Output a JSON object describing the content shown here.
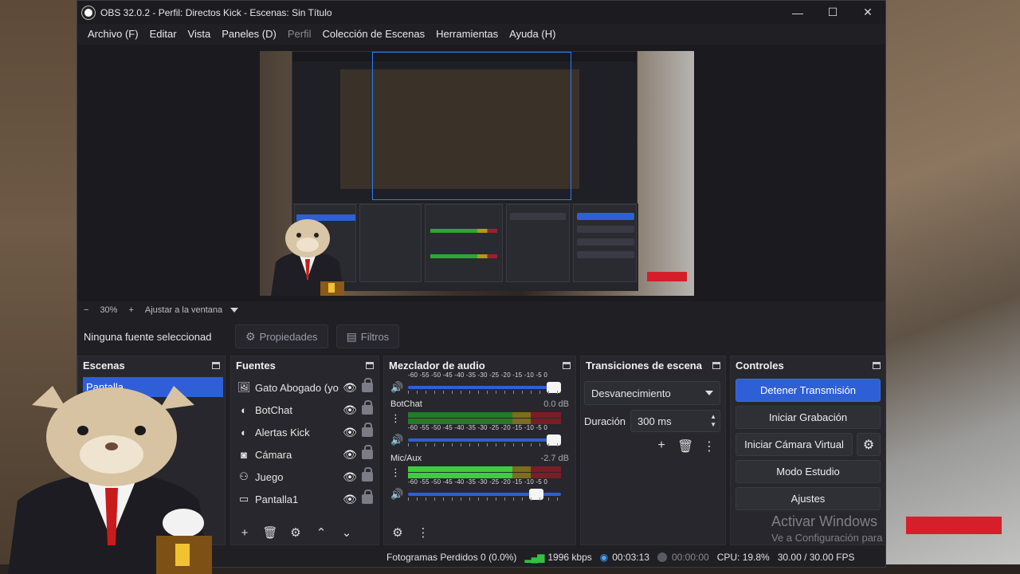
{
  "window": {
    "title": "OBS 32.0.2 - Perfil: Directos Kick - Escenas: Sin Título",
    "minimize": "—",
    "maximize": "☐",
    "close": "✕"
  },
  "menu": [
    "Archivo (F)",
    "Editar",
    "Vista",
    "Paneles (D)",
    "Perfil",
    "Colección de Escenas",
    "Herramientas",
    "Ayuda (H)"
  ],
  "zoom": {
    "minus": "−",
    "value": "30%",
    "plus": "+",
    "fit_label": "Ajustar a la ventana"
  },
  "source_toolbar": {
    "no_source": "Ninguna fuente seleccionad",
    "properties": "Propiedades",
    "filters": "Filtros"
  },
  "scenes": {
    "title": "Escenas",
    "items": [
      "Pantalla"
    ]
  },
  "sources": {
    "title": "Fuentes",
    "items": [
      {
        "name": "Gato Abogado (yo",
        "icon": "image-icon"
      },
      {
        "name": "BotChat",
        "icon": "browser-icon"
      },
      {
        "name": "Alertas Kick",
        "icon": "browser-icon"
      },
      {
        "name": "Cámara",
        "icon": "camera-icon"
      },
      {
        "name": "Juego",
        "icon": "gamepad-icon"
      },
      {
        "name": "Pantalla1",
        "icon": "monitor-icon"
      }
    ]
  },
  "mixer": {
    "title": "Mezclador de audio",
    "ticks": "-60 -55 -50 -45 -40 -35 -30 -25 -20 -15 -10 -5 0",
    "channels": [
      {
        "name": "",
        "db": "",
        "level": 0,
        "volume": 0.93
      },
      {
        "name": "BotChat",
        "db": "0.0 dB",
        "level": 0,
        "volume": 0.93
      },
      {
        "name": "Mic/Aux",
        "db": "-2.7 dB",
        "level": 0.78,
        "volume": 0.83
      }
    ]
  },
  "transitions": {
    "title": "Transiciones de escena",
    "selected": "Desvanecimiento",
    "duration_label": "Duración",
    "duration_value": "300 ms"
  },
  "controls": {
    "title": "Controles",
    "stop_stream": "Detener Transmisión",
    "start_recording": "Iniciar Grabación",
    "start_virtualcam": "Iniciar Cámara Virtual",
    "studio_mode": "Modo Estudio",
    "settings": "Ajustes"
  },
  "status": {
    "dropped": "Fotogramas Perdidos 0 (0.0%)",
    "bitrate": "1996 kbps",
    "stream_time": "00:03:13",
    "rec_time": "00:00:00",
    "cpu": "CPU: 19.8%",
    "fps": "30.00 / 30.00 FPS"
  },
  "watermark": {
    "line1": "Activar Windows",
    "line2": "Ve a Configuración para"
  },
  "colors": {
    "accent": "#2f5fd6",
    "panel": "#27272d",
    "window": "#1f1f24"
  }
}
